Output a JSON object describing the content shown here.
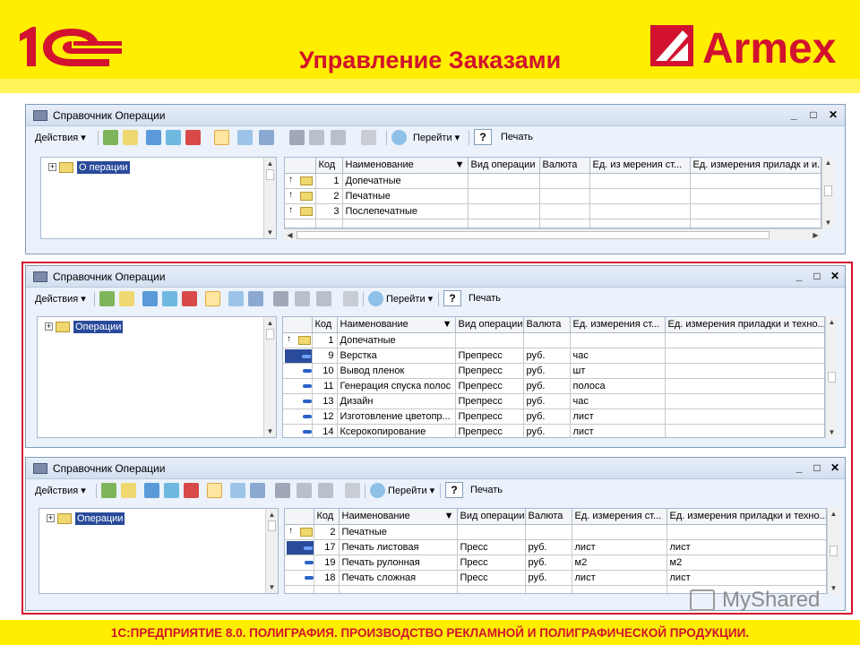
{
  "slide": {
    "title": "Управление Заказами",
    "brand_left": "1С",
    "brand_right": "Armex",
    "footer": "1С:ПРЕДПРИЯТИЕ 8.0. ПОЛИГРАФИЯ. ПРОИЗВОДСТВО РЕКЛАМНОЙ И ПОЛИГРАФИЧЕСКОЙ ПРОДУКЦИИ.",
    "watermark": "MyShared",
    "colors": {
      "background": "#ffee00",
      "accent": "#d2122e",
      "window": "#ebf2fb",
      "selection": "#2a4b9b"
    }
  },
  "toolbar": {
    "actions": "Действия ▾",
    "goto": "Перейти ▾",
    "help": "?",
    "print": "Печать"
  },
  "columns": [
    "Код",
    "Наименование",
    "Вид операции",
    "Валюта",
    "Ед. измерения ст...",
    "Ед. измерения приладки и техно..."
  ],
  "columns_w1": [
    "Код",
    "Наименование",
    "Вид операции",
    "Валюта",
    "Ед. из мерения ст...",
    "Ед. измерения приладк и и..."
  ],
  "windows": [
    {
      "title": "Справочник Операции",
      "tree_label": "О перации",
      "rows": [
        {
          "kind": "group",
          "code": "1",
          "name": "Допечатные",
          "op": "",
          "cur": "",
          "unit": "",
          "unit2": ""
        },
        {
          "kind": "group",
          "code": "2",
          "name": "Печатные",
          "op": "",
          "cur": "",
          "unit": "",
          "unit2": ""
        },
        {
          "kind": "group",
          "code": "3",
          "name": "Послепечатные",
          "op": "",
          "cur": "",
          "unit": "",
          "unit2": ""
        }
      ]
    },
    {
      "title": "Справочник Операции",
      "tree_label": "Операции",
      "rows": [
        {
          "kind": "group",
          "code": "1",
          "name": "Допечатные",
          "op": "",
          "cur": "",
          "unit": "",
          "unit2": ""
        },
        {
          "kind": "item-selected",
          "code": "9",
          "name": "Верстка",
          "op": "Препресс",
          "cur": "руб.",
          "unit": "час",
          "unit2": ""
        },
        {
          "kind": "item",
          "code": "10",
          "name": "Вывод пленок",
          "op": "Препресс",
          "cur": "руб.",
          "unit": "шт",
          "unit2": ""
        },
        {
          "kind": "item",
          "code": "11",
          "name": "Генерация спуска полос",
          "op": "Препресс",
          "cur": "руб.",
          "unit": "полоса",
          "unit2": ""
        },
        {
          "kind": "item",
          "code": "13",
          "name": "Дизайн",
          "op": "Препресс",
          "cur": "руб.",
          "unit": "час",
          "unit2": ""
        },
        {
          "kind": "item",
          "code": "12",
          "name": "Изготовление цветопр...",
          "op": "Препресс",
          "cur": "руб.",
          "unit": "лист",
          "unit2": ""
        },
        {
          "kind": "item",
          "code": "14",
          "name": "Ксерокопирование",
          "op": "Препресс",
          "cur": "руб.",
          "unit": "лист",
          "unit2": ""
        }
      ]
    },
    {
      "title": "Справочник Операции",
      "tree_label": "Операции",
      "rows": [
        {
          "kind": "group",
          "code": "2",
          "name": "Печатные",
          "op": "",
          "cur": "",
          "unit": "",
          "unit2": ""
        },
        {
          "kind": "item-selected",
          "code": "17",
          "name": "Печать листовая",
          "op": "Пресс",
          "cur": "руб.",
          "unit": "лист",
          "unit2": "лист"
        },
        {
          "kind": "item",
          "code": "19",
          "name": "Печать рулонная",
          "op": "Пресс",
          "cur": "руб.",
          "unit": "м2",
          "unit2": "м2"
        },
        {
          "kind": "item",
          "code": "18",
          "name": "Печать сложная",
          "op": "Пресс",
          "cur": "руб.",
          "unit": "лист",
          "unit2": "лист"
        }
      ]
    }
  ]
}
